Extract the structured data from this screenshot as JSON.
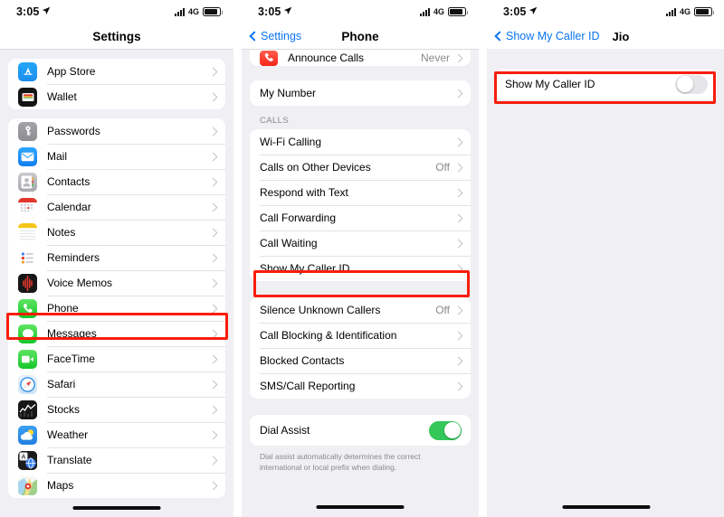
{
  "theme": {
    "accent_blue": "#0a74f0",
    "highlight_red": "#f91d0a",
    "toggle_on_green": "#34c759",
    "page_bg": "#efeff4",
    "card_bg": "#ffffff",
    "secondary_text": "#8a8a8e"
  },
  "panels": [
    {
      "id": "settings",
      "statusbar": {
        "time": "3:05",
        "location_icon": "location-arrow-icon",
        "network": "4G",
        "signal_icon": "cellular-signal-icon",
        "battery_icon": "battery-icon"
      },
      "navbar": {
        "title": "Settings",
        "back_label": "",
        "style": "centered"
      },
      "groups": [
        {
          "rows": [
            {
              "label": "App Store",
              "icon": "app-store-icon",
              "icon_class": "ic-appstore",
              "glyph": "A",
              "value": "",
              "accessory": "chevron"
            },
            {
              "label": "Wallet",
              "icon": "wallet-icon",
              "icon_class": "ic-wallet",
              "glyph": "▤",
              "value": "",
              "accessory": "chevron"
            }
          ]
        },
        {
          "rows": [
            {
              "label": "Passwords",
              "icon": "passwords-key-icon",
              "icon_class": "ic-pass",
              "glyph": "🔑",
              "value": "",
              "accessory": "chevron"
            },
            {
              "label": "Mail",
              "icon": "mail-icon",
              "icon_class": "ic-mail",
              "glyph": "✉",
              "value": "",
              "accessory": "chevron"
            },
            {
              "label": "Contacts",
              "icon": "contacts-icon",
              "icon_class": "ic-contacts",
              "glyph": "👤",
              "value": "",
              "accessory": "chevron"
            },
            {
              "label": "Calendar",
              "icon": "calendar-icon",
              "icon_class": "ic-cal",
              "glyph": "",
              "value": "",
              "accessory": "chevron"
            },
            {
              "label": "Notes",
              "icon": "notes-icon",
              "icon_class": "ic-notes",
              "glyph": "",
              "value": "",
              "accessory": "chevron"
            },
            {
              "label": "Reminders",
              "icon": "reminders-icon",
              "icon_class": "ic-rem",
              "glyph": "",
              "value": "",
              "accessory": "chevron"
            },
            {
              "label": "Voice Memos",
              "icon": "voice-memos-icon",
              "icon_class": "ic-voice",
              "glyph": "",
              "value": "",
              "accessory": "chevron"
            },
            {
              "label": "Phone",
              "icon": "phone-icon",
              "icon_class": "ic-phone",
              "glyph": "📞",
              "value": "",
              "accessory": "chevron",
              "highlighted": true
            },
            {
              "label": "Messages",
              "icon": "messages-icon",
              "icon_class": "ic-msg",
              "glyph": "💬",
              "value": "",
              "accessory": "chevron"
            },
            {
              "label": "FaceTime",
              "icon": "facetime-icon",
              "icon_class": "ic-ft",
              "glyph": "📹",
              "value": "",
              "accessory": "chevron"
            },
            {
              "label": "Safari",
              "icon": "safari-icon",
              "icon_class": "ic-safari",
              "glyph": "🧭",
              "value": "",
              "accessory": "chevron"
            },
            {
              "label": "Stocks",
              "icon": "stocks-icon",
              "icon_class": "ic-stocks",
              "glyph": "",
              "value": "",
              "accessory": "chevron"
            },
            {
              "label": "Weather",
              "icon": "weather-icon",
              "icon_class": "ic-weather",
              "glyph": "",
              "value": "",
              "accessory": "chevron"
            },
            {
              "label": "Translate",
              "icon": "translate-icon",
              "icon_class": "ic-translate",
              "glyph": "あ",
              "value": "",
              "accessory": "chevron"
            },
            {
              "label": "Maps",
              "icon": "maps-icon",
              "icon_class": "ic-maps",
              "glyph": "",
              "value": "",
              "accessory": "chevron"
            }
          ]
        }
      ]
    },
    {
      "id": "phone",
      "statusbar": {
        "time": "3:05",
        "location_icon": "location-arrow-icon",
        "network": "4G",
        "signal_icon": "cellular-signal-icon",
        "battery_icon": "battery-icon"
      },
      "navbar": {
        "title": "Phone",
        "back_label": "Settings",
        "style": "centered-with-back"
      },
      "clipped_top_row": {
        "label": "Announce Calls",
        "value": "Never",
        "icon": "announce-calls-icon"
      },
      "groups": [
        {
          "header": "",
          "rows": [
            {
              "label": "My Number",
              "value": "",
              "accessory": "chevron"
            }
          ]
        },
        {
          "header": "CALLS",
          "rows": [
            {
              "label": "Wi-Fi Calling",
              "value": "",
              "accessory": "chevron"
            },
            {
              "label": "Calls on Other Devices",
              "value": "Off",
              "accessory": "chevron"
            },
            {
              "label": "Respond with Text",
              "value": "",
              "accessory": "chevron"
            },
            {
              "label": "Call Forwarding",
              "value": "",
              "accessory": "chevron"
            },
            {
              "label": "Call Waiting",
              "value": "",
              "accessory": "chevron"
            },
            {
              "label": "Show My Caller ID",
              "value": "",
              "accessory": "chevron",
              "highlighted": true
            }
          ]
        },
        {
          "header": "",
          "rows": [
            {
              "label": "Silence Unknown Callers",
              "value": "Off",
              "accessory": "chevron"
            },
            {
              "label": "Call Blocking & Identification",
              "value": "",
              "accessory": "chevron"
            },
            {
              "label": "Blocked Contacts",
              "value": "",
              "accessory": "chevron"
            },
            {
              "label": "SMS/Call Reporting",
              "value": "",
              "accessory": "chevron"
            }
          ]
        },
        {
          "header": "",
          "rows": [
            {
              "label": "Dial Assist",
              "value": "",
              "accessory": "toggle-on"
            }
          ],
          "footnote": "Dial assist automatically determines the correct international or local prefix when dialing."
        }
      ]
    },
    {
      "id": "caller-id",
      "statusbar": {
        "time": "3:05",
        "location_icon": "location-arrow-icon",
        "network": "4G",
        "signal_icon": "cellular-signal-icon",
        "battery_icon": "battery-icon"
      },
      "navbar": {
        "title": "Jio",
        "back_label": "Show My Caller ID",
        "style": "left"
      },
      "groups": [
        {
          "rows": [
            {
              "label": "Show My Caller ID",
              "value": "",
              "accessory": "toggle-off",
              "highlighted": true
            }
          ]
        }
      ]
    }
  ]
}
